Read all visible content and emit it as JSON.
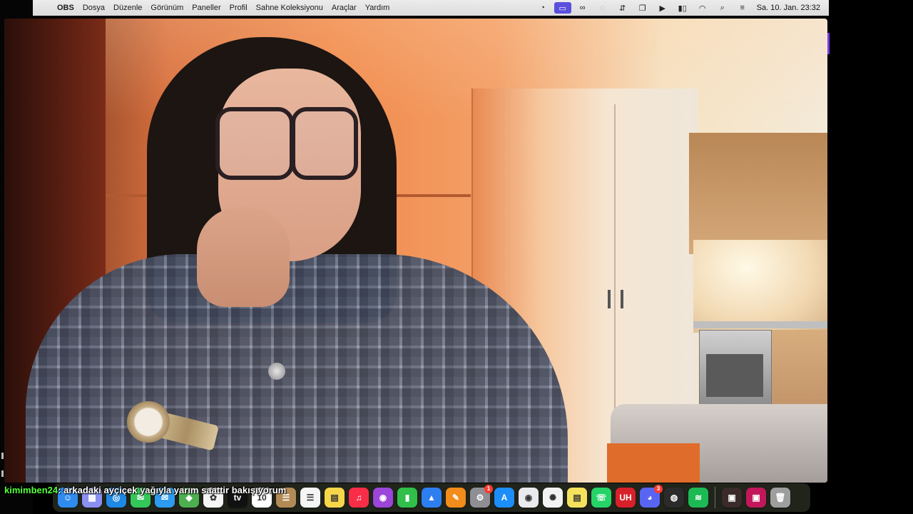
{
  "menubar": {
    "app_name": "OBS",
    "menus": [
      "Dosya",
      "Düzenle",
      "Görünüm",
      "Paneller",
      "Profil",
      "Sahne Koleksiyonu",
      "Araçlar",
      "Yardım"
    ],
    "clock": "Sa. 10. Jan.  23:32",
    "status_icons": [
      "obs-status-icon",
      "screen-record-icon",
      "creative-cloud-icon",
      "circle-icon",
      "airplay-icon",
      "window-icon",
      "play-icon",
      "battery-icon",
      "wifi-icon",
      "search-icon",
      "control-center-icon"
    ]
  },
  "chat": {
    "username": "kimimben24",
    "message": ": arkadaki ayçiçek yağıyla yarım saattir bakışıyorum"
  },
  "dock": {
    "apps": [
      {
        "name": "finder",
        "glyph": "☺",
        "color": "#2f8bf0"
      },
      {
        "name": "launchpad",
        "glyph": "▦",
        "color": "#8a8ff0"
      },
      {
        "name": "safari",
        "glyph": "◎",
        "color": "#1e88e5"
      },
      {
        "name": "messages",
        "glyph": "✉",
        "color": "#34c759"
      },
      {
        "name": "mail",
        "glyph": "✉",
        "color": "#2d9cf0"
      },
      {
        "name": "maps",
        "glyph": "◆",
        "color": "#4caf50"
      },
      {
        "name": "photos",
        "glyph": "✿",
        "color": "#f5f5f5"
      },
      {
        "name": "apple-tv",
        "glyph": "tv",
        "color": "#111111"
      },
      {
        "name": "calendar",
        "glyph": "10",
        "color": "#ffffff"
      },
      {
        "name": "contacts",
        "glyph": "☰",
        "color": "#b28a55"
      },
      {
        "name": "reminders",
        "glyph": "☰",
        "color": "#f5f5f5"
      },
      {
        "name": "notes",
        "glyph": "▤",
        "color": "#f7d64a"
      },
      {
        "name": "music",
        "glyph": "♫",
        "color": "#fa2d48"
      },
      {
        "name": "podcasts",
        "glyph": "◉",
        "color": "#9b45d9"
      },
      {
        "name": "numbers",
        "glyph": "▮",
        "color": "#2fbf4a"
      },
      {
        "name": "keynote",
        "glyph": "▲",
        "color": "#2d7ff0"
      },
      {
        "name": "pages",
        "glyph": "✎",
        "color": "#f28c1b"
      },
      {
        "name": "system-settings",
        "glyph": "⚙",
        "color": "#8e8e93",
        "badge": "1"
      },
      {
        "name": "app-store",
        "glyph": "A",
        "color": "#1c8ef9"
      },
      {
        "name": "chrome",
        "glyph": "◉",
        "color": "#e8eaed"
      },
      {
        "name": "chatgpt",
        "glyph": "✺",
        "color": "#f2f2f2"
      },
      {
        "name": "stickies",
        "glyph": "▤",
        "color": "#f5e25c"
      },
      {
        "name": "whatsapp",
        "glyph": "☏",
        "color": "#25d366"
      },
      {
        "name": "uhu",
        "glyph": "UH",
        "color": "#d8202a"
      },
      {
        "name": "discord",
        "glyph": "◕",
        "color": "#5865f2",
        "badge": "3"
      },
      {
        "name": "obs",
        "glyph": "◍",
        "color": "#2b2b2b"
      },
      {
        "name": "spotify",
        "glyph": "≋",
        "color": "#1db954"
      }
    ],
    "recent": [
      {
        "name": "recent-window-1",
        "glyph": "▣",
        "color": "#3a2a2a"
      },
      {
        "name": "recent-window-2",
        "glyph": "▣",
        "color": "#c2185b"
      },
      {
        "name": "trash",
        "glyph": "🗑",
        "color": "#9e9e9e"
      }
    ]
  }
}
